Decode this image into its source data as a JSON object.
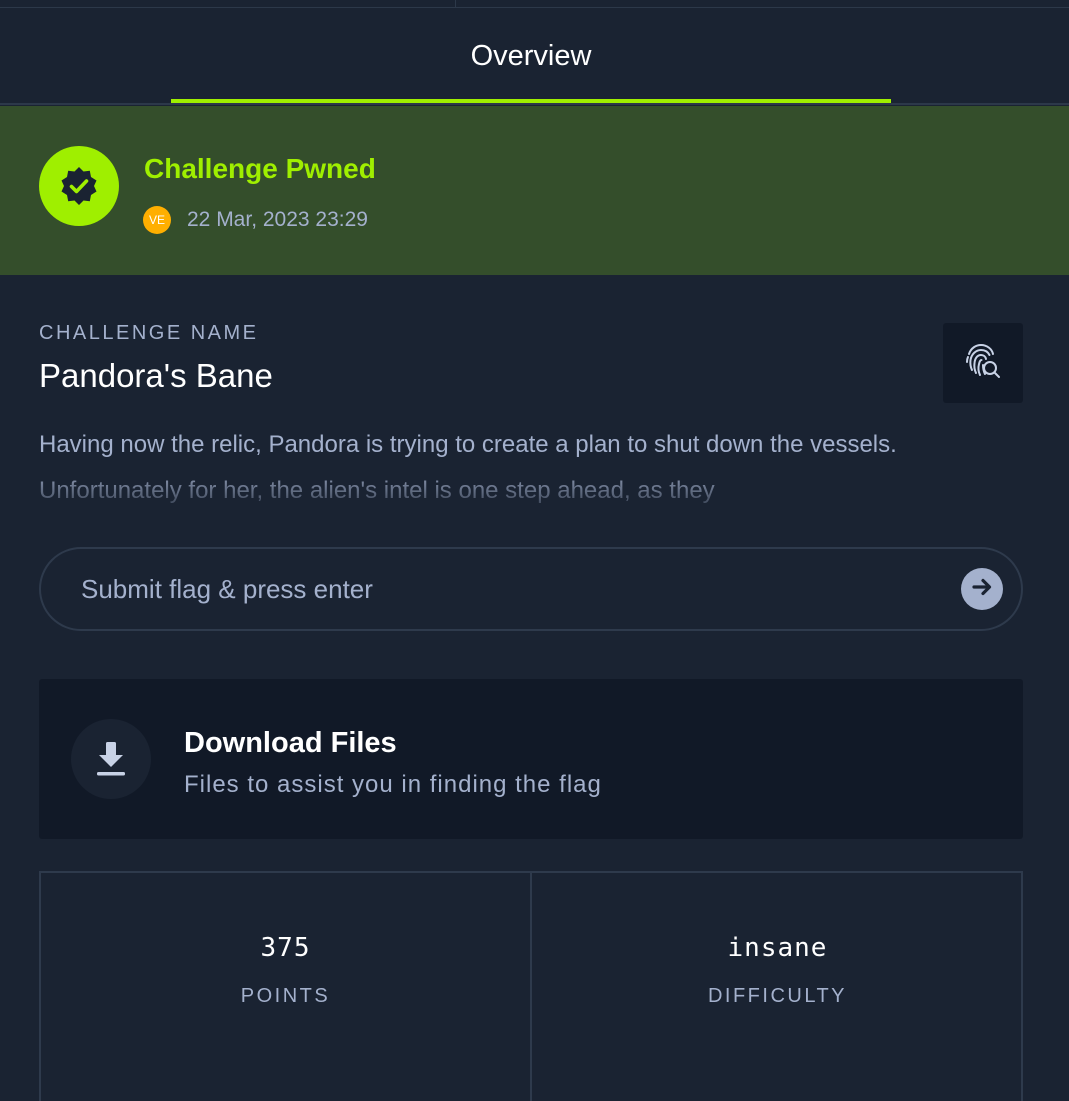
{
  "tabs": {
    "overview_label": "Overview"
  },
  "pwned": {
    "title": "Challenge Pwned",
    "vip_badge": "VE",
    "date": "22 Mar, 2023 23:29"
  },
  "challenge": {
    "section_label": "CHALLENGE NAME",
    "name": "Pandora's Bane",
    "description": "Having now the relic, Pandora is trying to create a plan to shut down the vessels. Unfortunately for her, the alien's intel is one step ahead, as they"
  },
  "flag": {
    "placeholder": "Submit flag & press enter"
  },
  "download": {
    "title": "Download Files",
    "subtitle": "Files to assist you in finding the flag"
  },
  "stats": {
    "points_value": "375",
    "points_label": "POINTS",
    "difficulty_value": "insane",
    "difficulty_label": "DIFFICULTY"
  },
  "colors": {
    "background": "#1a2332",
    "accent": "#9fef00",
    "pwned_banner": "#344e2b",
    "muted_text": "#a4b1cd",
    "card": "#111927",
    "vip_badge": "#ffaf00"
  },
  "icons": {
    "pwned_badge": "verified-badge-icon",
    "fingerprint": "fingerprint-search-icon",
    "submit": "arrow-right-icon",
    "download": "download-icon"
  }
}
